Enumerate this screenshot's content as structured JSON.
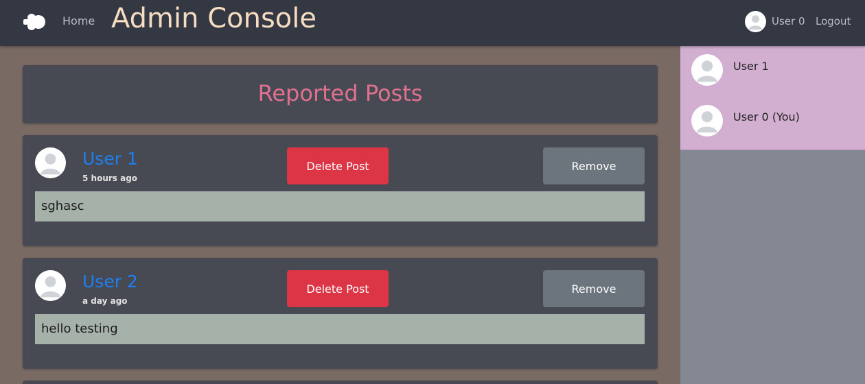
{
  "navbar": {
    "logo_icon": "cloud-logo-icon",
    "home_label": "Home",
    "title": "Admin Console",
    "user_avatar_icon": "avatar-icon",
    "user_label": "User 0",
    "logout_label": "Logout"
  },
  "header": {
    "title": "Reported Posts"
  },
  "posts": [
    {
      "user": "User 1",
      "time": "5 hours ago",
      "text": "sghasc",
      "delete_label": "Delete Post",
      "remove_label": "Remove"
    },
    {
      "user": "User 2",
      "time": "a day ago",
      "text": "hello testing",
      "delete_label": "Delete Post",
      "remove_label": "Remove"
    }
  ],
  "sidebar": {
    "users": [
      {
        "label": "User 1",
        "avatar_icon": "avatar-icon"
      },
      {
        "label": "User 0 (You)",
        "avatar_icon": "avatar-icon"
      }
    ]
  },
  "colors": {
    "navbar": "#343842",
    "title": "#f6dcc0",
    "page_background": "#7a6a64",
    "card": "#474a53",
    "reported_title": "#e0728f",
    "username_link": "#1e7ff0",
    "delete_button": "#dc3545",
    "remove_button": "#6c757d",
    "post_body": "#a6b2a9",
    "sidebar_item": "#d2afd1",
    "sidebar_bg": "#838892"
  }
}
